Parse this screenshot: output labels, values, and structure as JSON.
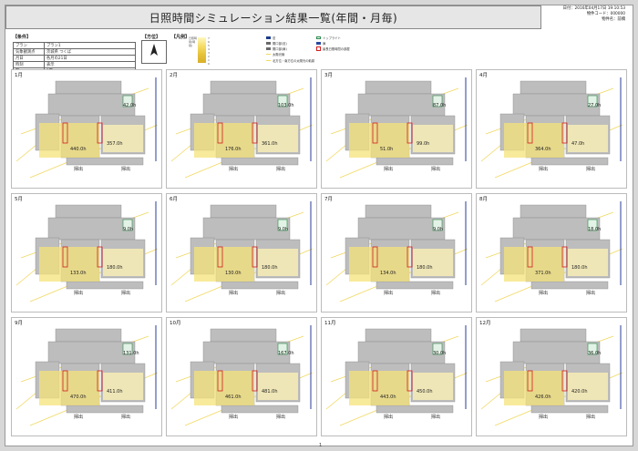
{
  "title": "日照時間シミュレーション結果一覧(年間・月毎)",
  "meta": {
    "date_line": "日付：2016年04月17日 19:10:53",
    "code_line": "物件コード：000000",
    "name_line": "物件名：前橋"
  },
  "sections": {
    "conditions": "【条件】",
    "direction": "【方位】",
    "legend": "【凡例】"
  },
  "conditions": [
    {
      "key": "プラン",
      "value": "プラン1"
    },
    {
      "key": "気象観測点",
      "value": "茨城県 つくば"
    },
    {
      "key": "月日",
      "value": "各月の21日"
    },
    {
      "key": "時刻",
      "value": "表示"
    },
    {
      "key": "階",
      "value": "1階"
    }
  ],
  "legend": {
    "ramp_title": "日照時間(時間)",
    "ramp_labels": [
      "7",
      "6",
      "5",
      "4",
      "3",
      "2",
      "1",
      "0"
    ],
    "items": [
      {
        "label": "窓",
        "color": "#1c3c8a"
      },
      {
        "label": "開口部(窓)",
        "color": "#6a6a6a"
      },
      {
        "label": "開口部(扉)",
        "color": "#6a6a6a"
      },
      {
        "label": "太陽光線",
        "color": "#f2d860"
      },
      {
        "label": "トップライト",
        "color": "#2a8a4a"
      },
      {
        "label": "扉",
        "color": "#2a4aa0"
      },
      {
        "label": "最長日照時間の部屋",
        "color": "#d21f1f"
      },
      {
        "label": "北方位・南方位の太陽光の軌跡",
        "color": "#f2d860"
      }
    ]
  },
  "months": [
    {
      "label": "1月",
      "ldk": "440.0h",
      "room_a": "357.0h",
      "room_b": "42.0h",
      "exit": "掃出"
    },
    {
      "label": "2月",
      "ldk": "176.0h",
      "room_a": "361.0h",
      "room_b": "103.0h",
      "exit": "掃出"
    },
    {
      "label": "3月",
      "ldk": "51.0h",
      "room_a": "99.0h",
      "room_b": "87.0h",
      "exit": "掃出"
    },
    {
      "label": "4月",
      "ldk": "364.0h",
      "room_a": "47.0h",
      "room_b": "27.0h",
      "exit": "掃出"
    },
    {
      "label": "5月",
      "ldk": "133.0h",
      "room_a": "180.0h",
      "room_b": "9.0h",
      "exit": "掃出"
    },
    {
      "label": "6月",
      "ldk": "130.0h",
      "room_a": "180.0h",
      "room_b": "9.0h",
      "exit": "掃出"
    },
    {
      "label": "7月",
      "ldk": "134.0h",
      "room_a": "180.0h",
      "room_b": "9.0h",
      "exit": "掃出"
    },
    {
      "label": "8月",
      "ldk": "371.0h",
      "room_a": "180.0h",
      "room_b": "18.0h",
      "exit": "掃出"
    },
    {
      "label": "9月",
      "ldk": "470.0h",
      "room_a": "411.0h",
      "room_b": "131.0h",
      "exit": "掃出"
    },
    {
      "label": "10月",
      "ldk": "461.0h",
      "room_a": "481.0h",
      "room_b": "167.0h",
      "exit": "掃出"
    },
    {
      "label": "11月",
      "ldk": "443.0h",
      "room_a": "450.0h",
      "room_b": "30.0h",
      "exit": "掃出"
    },
    {
      "label": "12月",
      "ldk": "426.0h",
      "room_a": "420.0h",
      "room_b": "36.0h",
      "exit": "掃出"
    }
  ],
  "page_number": "1"
}
